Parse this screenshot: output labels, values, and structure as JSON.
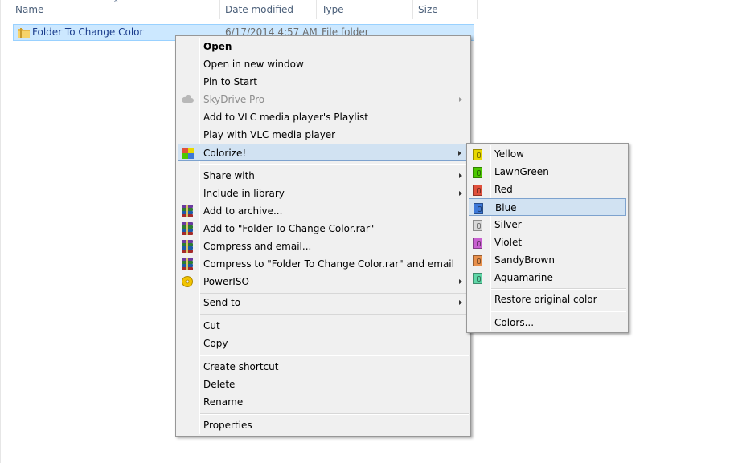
{
  "columns": {
    "name": "Name",
    "date_modified": "Date modified",
    "type": "Type",
    "size": "Size"
  },
  "file": {
    "name": "Folder To Change Color",
    "date": "6/17/2014 4:57 AM",
    "type": "File folder"
  },
  "context_menu": {
    "open": "Open",
    "open_new_window": "Open in new window",
    "pin_to_start": "Pin to Start",
    "skydrive_pro": "SkyDrive Pro",
    "add_vlc_playlist": "Add to VLC media player's Playlist",
    "play_vlc": "Play with VLC media player",
    "colorize": "Colorize!",
    "share_with": "Share with",
    "include_in_library": "Include in library",
    "add_to_archive": "Add to archive...",
    "add_to_rar": "Add to \"Folder To Change Color.rar\"",
    "compress_email": "Compress and email...",
    "compress_rar_email": "Compress to \"Folder To Change Color.rar\" and email",
    "poweriso": "PowerISO",
    "send_to": "Send to",
    "cut": "Cut",
    "copy": "Copy",
    "create_shortcut": "Create shortcut",
    "delete": "Delete",
    "rename": "Rename",
    "properties": "Properties"
  },
  "colorize_menu": {
    "colors": [
      {
        "label": "Yellow",
        "color": "#e8d800"
      },
      {
        "label": "LawnGreen",
        "color": "#4cc800"
      },
      {
        "label": "Red",
        "color": "#e0503c"
      },
      {
        "label": "Blue",
        "color": "#3c78d8"
      },
      {
        "label": "Silver",
        "color": "#d8d8d8"
      },
      {
        "label": "Violet",
        "color": "#c860d0"
      },
      {
        "label": "SandyBrown",
        "color": "#e8904c"
      },
      {
        "label": "Aquamarine",
        "color": "#60d8a8"
      }
    ],
    "restore": "Restore original color",
    "more_colors": "Colors..."
  },
  "highlight_color": "#d1e2f2"
}
